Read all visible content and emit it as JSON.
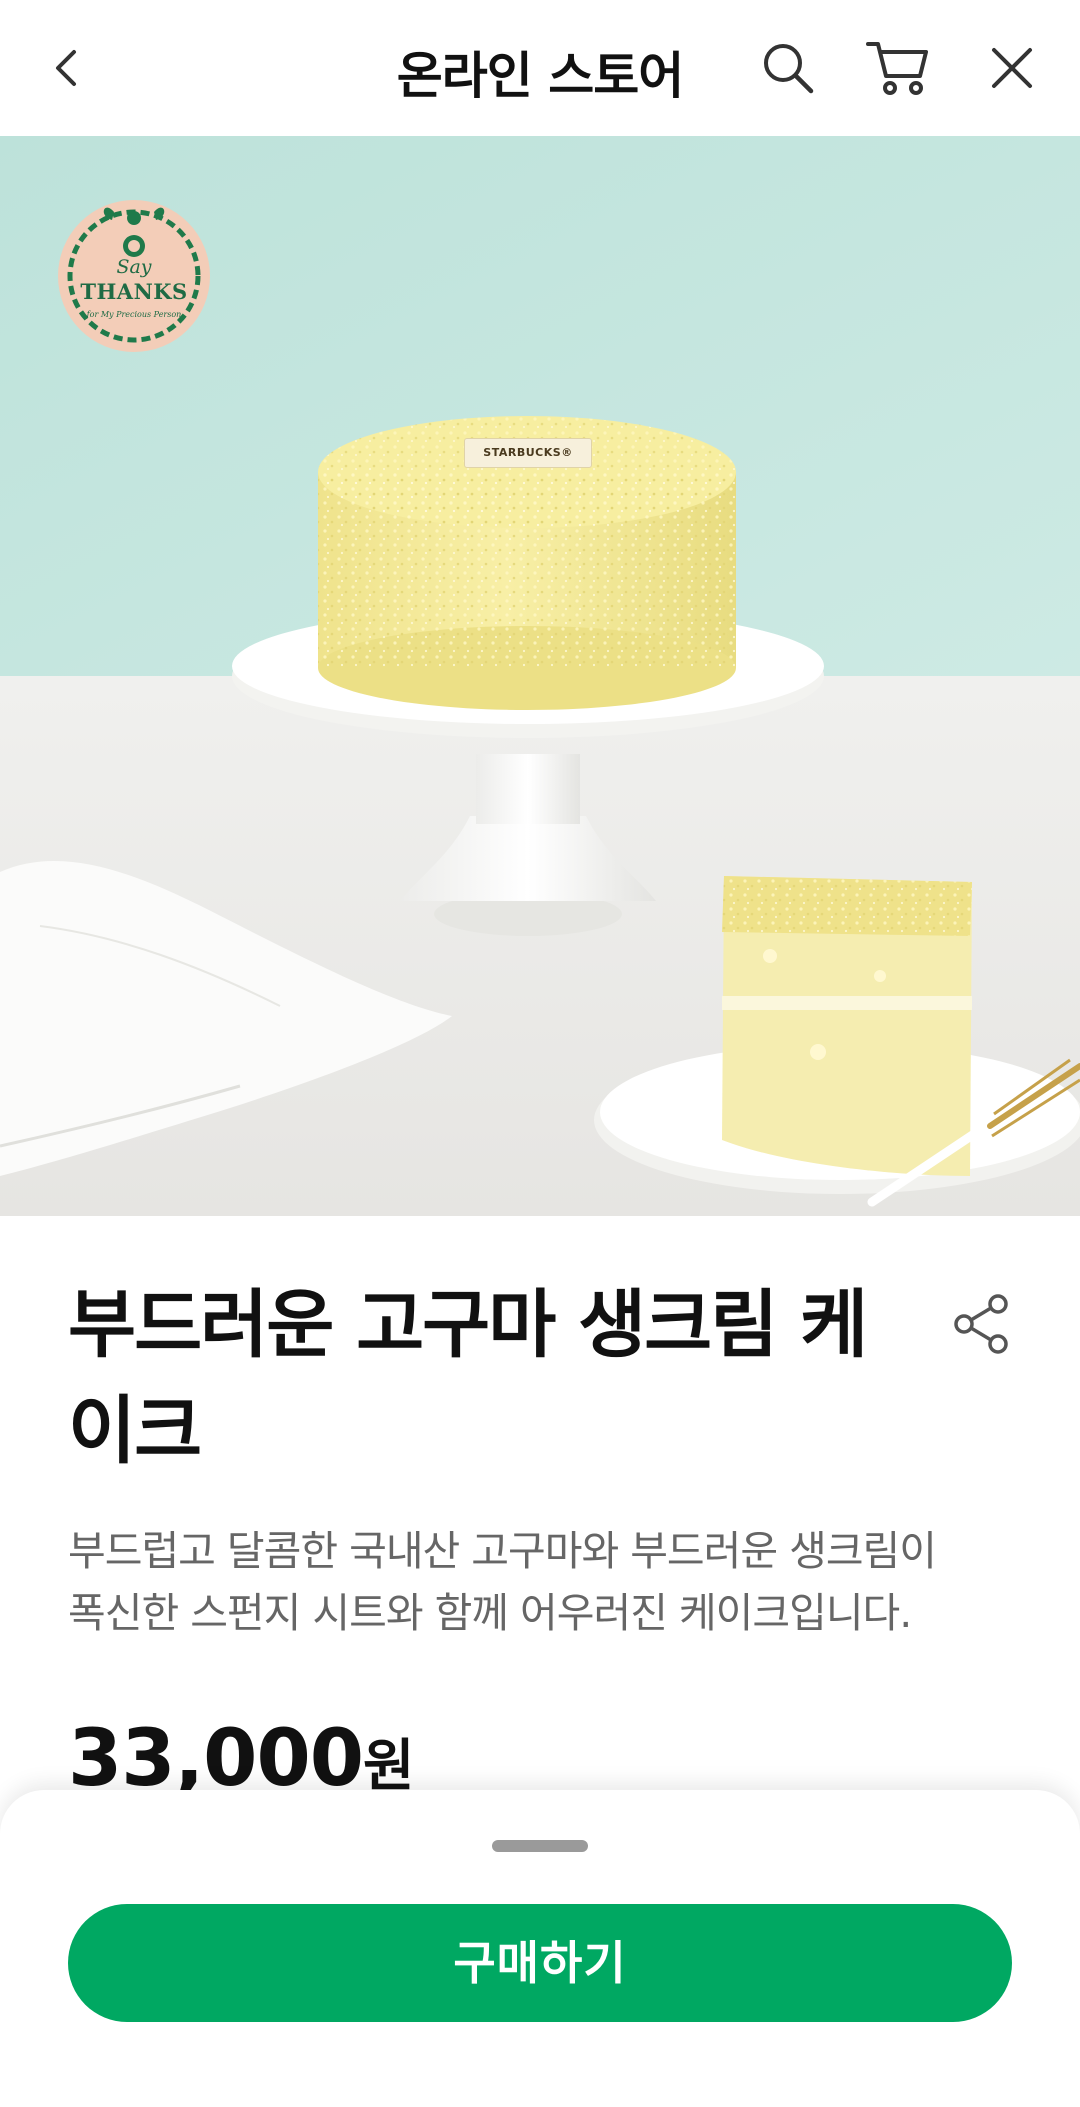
{
  "header": {
    "title": "온라인 스토어",
    "back_icon": "chevron-left-icon",
    "search_icon": "search-icon",
    "cart_icon": "cart-icon",
    "close_icon": "close-icon"
  },
  "hero": {
    "badge": {
      "say": "Say",
      "thanks": "THANKS",
      "sub": "for My Precious Person"
    },
    "cake_brand": "STARBUCKS®"
  },
  "product": {
    "name": "부드러운 고구마 생크림 케이크",
    "name_line1": "부드러운 고구마 생크림 케",
    "name_line2": "이크",
    "description_line1": "부드럽고 달콤한 국내산 고구마와 부드러운 생크림이",
    "description_line2": "폭신한 스펀지 시트와 함께 어우러진 케이크입니다.",
    "price_value": "33,000",
    "price_unit": "원"
  },
  "bottom_sheet": {
    "buy_label": "구매하기"
  },
  "colors": {
    "accent_green": "#00a862",
    "badge_green": "#1f6b45",
    "text_primary": "#111111",
    "text_secondary": "#666666"
  }
}
